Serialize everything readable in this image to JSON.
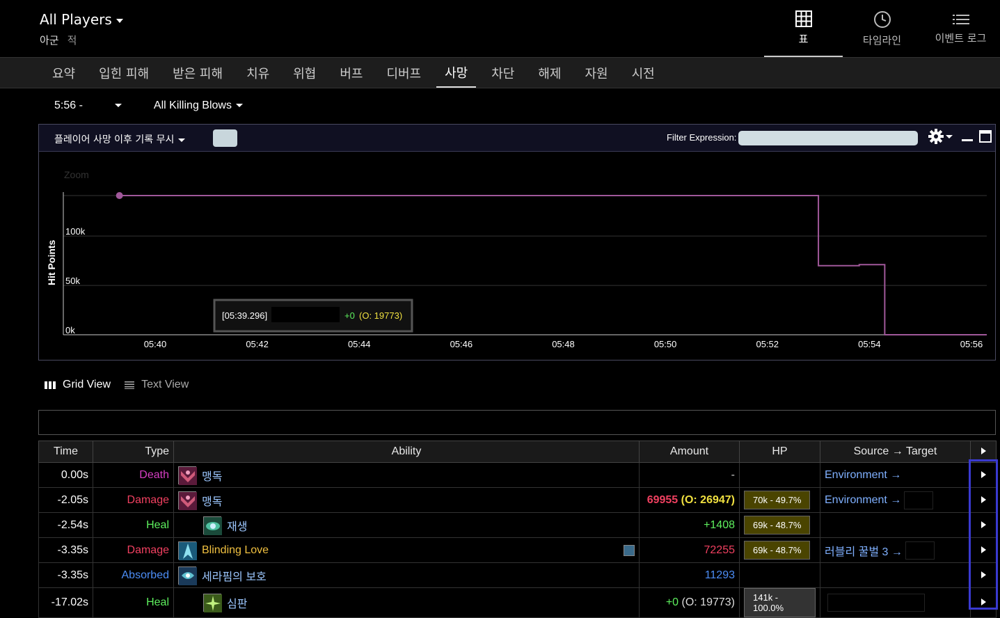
{
  "header": {
    "player_selector": "All Players",
    "factions": [
      "아군",
      "적"
    ],
    "view_tabs": [
      {
        "label": "표",
        "icon": "table-grid-icon",
        "active": true
      },
      {
        "label": "타임라인",
        "icon": "clock-icon",
        "active": false
      },
      {
        "label": "이벤트 로그",
        "icon": "list-icon",
        "active": false
      }
    ]
  },
  "nav": {
    "items": [
      "요약",
      "입힌 피해",
      "받은 피해",
      "치유",
      "위협",
      "버프",
      "디버프",
      "사망",
      "차단",
      "해제",
      "자원",
      "시전"
    ],
    "active": "사망"
  },
  "filters": {
    "time": "5:56 -",
    "killing_blows": "All Killing Blows"
  },
  "chart_panel": {
    "ignore_dropdown": "플레이어 사망 이후 기록 무시",
    "filter_label": "Filter Expression:",
    "tooltip_time": "[05:39.296]",
    "tooltip_delta": "+0",
    "tooltip_overheal": "(O: 19773)"
  },
  "chart_data": {
    "type": "line",
    "title": "",
    "zoom_label": "Zoom",
    "ylabel": "Hit Points",
    "ylim": [
      0,
      141000
    ],
    "yticks": [
      "0k",
      "50k",
      "100k"
    ],
    "xticks": [
      "05:40",
      "05:42",
      "05:44",
      "05:46",
      "05:48",
      "05:50",
      "05:52",
      "05:54",
      "05:56"
    ],
    "series": [
      {
        "color": "#a0589a",
        "points": [
          {
            "t": "05:39.3",
            "hp": 141000
          },
          {
            "t": "05:53.0",
            "hp": 141000
          },
          {
            "t": "05:53.0",
            "hp": 70000
          },
          {
            "t": "05:53.8",
            "hp": 70000
          },
          {
            "t": "05:53.8",
            "hp": 71000
          },
          {
            "t": "05:54.3",
            "hp": 71000
          },
          {
            "t": "05:54.3",
            "hp": 0
          },
          {
            "t": "05:56.3",
            "hp": 0
          }
        ]
      }
    ]
  },
  "view_toggle": {
    "grid": "Grid View",
    "text": "Text View"
  },
  "table": {
    "headers": [
      "Time",
      "Type",
      "Ability",
      "Amount",
      "HP",
      "Source → Target"
    ],
    "rows": [
      {
        "time": "0.00s",
        "type": "Death",
        "type_class": "death",
        "ability": "맹독",
        "icon": "rogue-poison-icon",
        "indent": false,
        "amount_main": "-",
        "amount_extra": "",
        "amount_class": "",
        "hp": "",
        "hp_class": "",
        "source": "Environment →",
        "redact_w": 0
      },
      {
        "time": "-2.05s",
        "type": "Damage",
        "type_class": "damage",
        "ability": "맹독",
        "icon": "rogue-poison-icon",
        "indent": false,
        "amount_main": "69955",
        "amount_extra": " (O: 26947)",
        "amount_class": "damage",
        "hp": "70k - 49.7%",
        "hp_class": "hpyel",
        "source": "Environment →",
        "redact_w": 42
      },
      {
        "time": "-2.54s",
        "type": "Heal",
        "type_class": "heal",
        "ability": "재생",
        "icon": "rejuvenation-icon",
        "indent": true,
        "amount_main": "+1408",
        "amount_extra": "",
        "amount_class": "heal",
        "hp": "69k - 48.7%",
        "hp_class": "hpyel",
        "source": "",
        "redact_w": 0
      },
      {
        "time": "-3.35s",
        "type": "Damage",
        "type_class": "damage",
        "ability": "Blinding Love",
        "icon": "blinding-love-icon",
        "indent": false,
        "amount_main": "72255",
        "amount_extra": "",
        "amount_class": "damage",
        "hp": "69k - 48.7%",
        "hp_class": "hpyel",
        "source": "러블리 꿀벌 3 →",
        "redact_w": 42
      },
      {
        "time": "-3.35s",
        "type": "Absorbed",
        "type_class": "absorbed",
        "ability": "세라핌의 보호",
        "icon": "seraphim-shield-icon",
        "indent": false,
        "amount_main": "11293",
        "amount_extra": "",
        "amount_class": "absorbed",
        "hp": "",
        "hp_class": "",
        "source": "",
        "redact_w": 0
      },
      {
        "time": "-17.02s",
        "type": "Heal",
        "type_class": "heal",
        "ability": "심판",
        "icon": "judgment-icon",
        "indent": true,
        "amount_main": "+0",
        "amount_extra": " (O: 19773)",
        "amount_class": "heal",
        "hp": "141k - 100.0%",
        "hp_class": "hpgrey",
        "source": "",
        "redact_w": 140
      }
    ]
  },
  "colors": {
    "accent": "#3a3ad0",
    "death": "#d63ec4",
    "damage": "#f04060",
    "heal": "#5ef05e",
    "absorbed": "#4c8df6",
    "overkill": "#f0e040"
  }
}
